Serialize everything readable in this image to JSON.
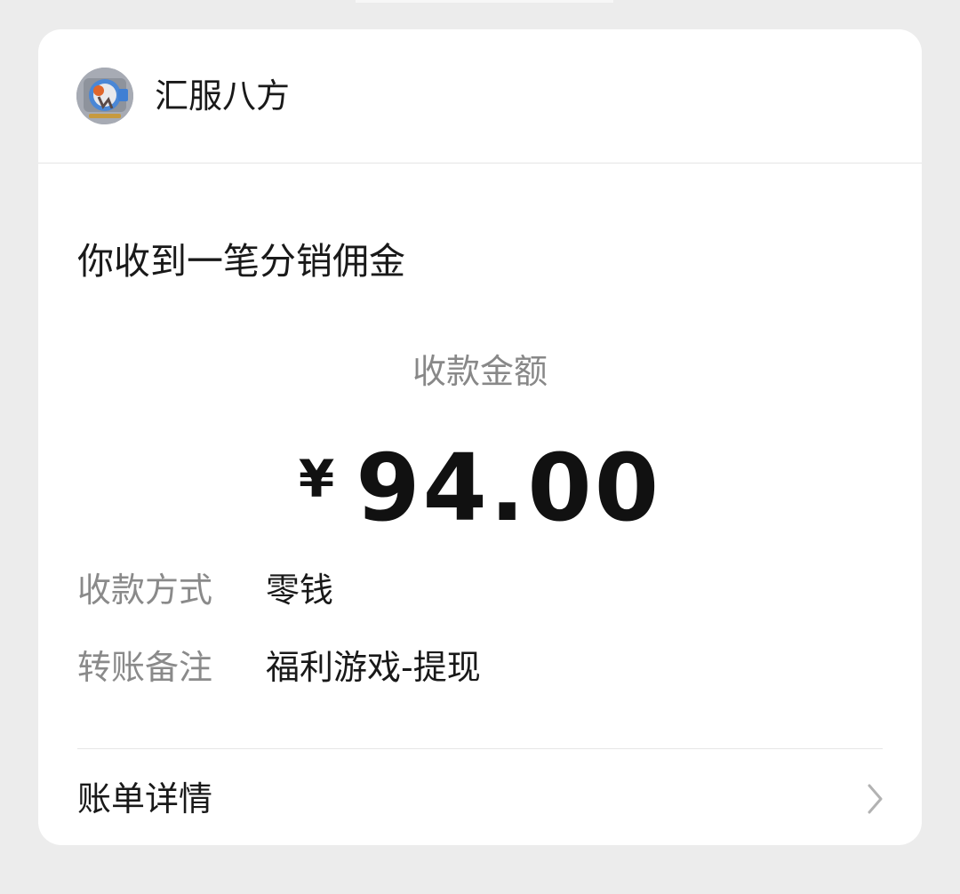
{
  "header": {
    "merchant_name": "汇服八方",
    "avatar_icon": "merchant-avatar"
  },
  "notice": {
    "title": "你收到一笔分销佣金"
  },
  "amount": {
    "label": "收款金额",
    "currency": "¥",
    "value": "94.00"
  },
  "details": [
    {
      "label": "收款方式",
      "value": "零钱"
    },
    {
      "label": "转账备注",
      "value": "福利游戏-提现"
    }
  ],
  "bill": {
    "label": "账单详情",
    "icon": "chevron-right-icon"
  },
  "colors": {
    "background": "#ececec",
    "card": "#ffffff",
    "primary_text": "#191919",
    "secondary_text": "#888888",
    "divider": "#e5e5e5"
  }
}
